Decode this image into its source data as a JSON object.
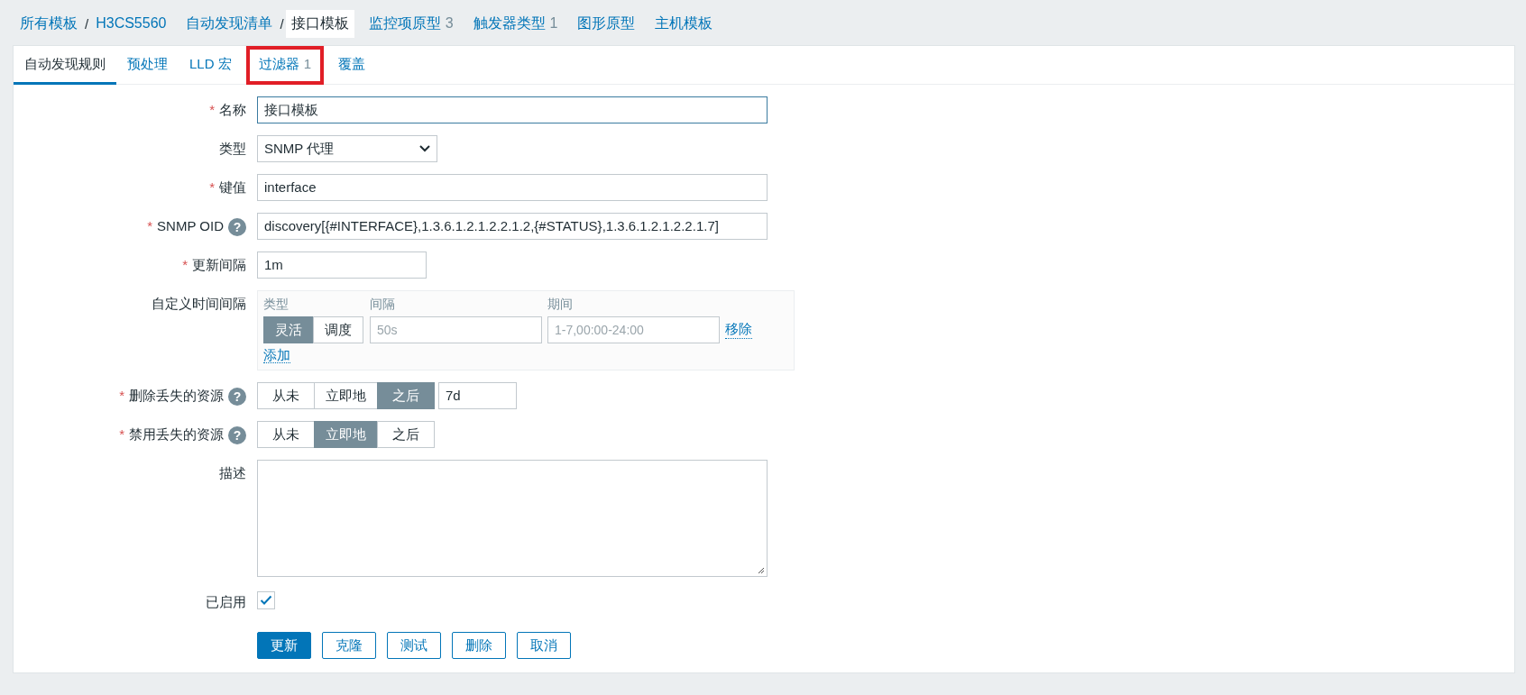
{
  "nav": [
    {
      "kind": "link",
      "label": "所有模板"
    },
    {
      "kind": "separator",
      "label": "/"
    },
    {
      "kind": "link",
      "label": "H3CS5560"
    },
    {
      "kind": "link",
      "label": "自动发现清单"
    },
    {
      "kind": "separator",
      "label": "/"
    },
    {
      "kind": "current",
      "label": "接口模板"
    },
    {
      "kind": "link",
      "label": "监控项原型",
      "count": "3"
    },
    {
      "kind": "link",
      "label": "触发器类型",
      "count": "1"
    },
    {
      "kind": "link",
      "label": "图形原型"
    },
    {
      "kind": "link",
      "label": "主机模板"
    }
  ],
  "tabs": [
    {
      "label": "自动发现规则",
      "selected": true,
      "highlighted": false
    },
    {
      "label": "预处理",
      "selected": false,
      "highlighted": false
    },
    {
      "label": "LLD 宏",
      "selected": false,
      "highlighted": false
    },
    {
      "label": "过滤器",
      "count": "1",
      "selected": false,
      "highlighted": true
    },
    {
      "label": "覆盖",
      "selected": false,
      "highlighted": false
    }
  ],
  "fields": [
    {
      "kind": "text",
      "label": "名称",
      "required": "*",
      "value": "接口模板",
      "focused": true
    },
    {
      "kind": "select",
      "label": "类型",
      "value": "SNMP 代理"
    },
    {
      "kind": "text",
      "label": "键值",
      "required": "*",
      "value": "interface",
      "focused": false
    },
    {
      "kind": "text",
      "label": "SNMP OID",
      "required": "*",
      "help": "?",
      "value": "discovery[{#INTERFACE},1.3.6.1.2.1.2.2.1.2,{#STATUS},1.3.6.1.2.1.2.2.1.7]",
      "focused": false
    },
    {
      "kind": "text-short",
      "label": "更新间隔",
      "required": "*",
      "value": "1m",
      "focused": false
    },
    {
      "kind": "intervals",
      "label": "自定义时间间隔",
      "headers": [
        "类型",
        "间隔",
        "期间"
      ],
      "rows": [
        {
          "options": [
            {
              "label": "灵活",
              "selected": true
            },
            {
              "label": "调度",
              "selected": false
            }
          ],
          "interval_placeholder": "50s",
          "period_placeholder": "1-7,00:00-24:00",
          "remove": "移除"
        }
      ],
      "add": "添加"
    },
    {
      "kind": "segmented",
      "label": "删除丢失的资源",
      "required": "*",
      "help": "?",
      "options": [
        {
          "label": "从未",
          "selected": false
        },
        {
          "label": "立即地",
          "selected": false
        },
        {
          "label": "之后",
          "selected": true
        }
      ],
      "value": "7d"
    },
    {
      "kind": "segmented",
      "label": "禁用丢失的资源",
      "required": "*",
      "help": "?",
      "options": [
        {
          "label": "从未",
          "selected": false
        },
        {
          "label": "立即地",
          "selected": true
        },
        {
          "label": "之后",
          "selected": false
        }
      ]
    },
    {
      "kind": "textarea",
      "label": "描述"
    },
    {
      "kind": "checkbox",
      "label": "已启用",
      "checked": true
    }
  ],
  "buttons": [
    {
      "label": "更新",
      "primary": true
    },
    {
      "label": "克隆",
      "primary": false
    },
    {
      "label": "测试",
      "primary": false
    },
    {
      "label": "删除",
      "primary": false
    },
    {
      "label": "取消",
      "primary": false
    }
  ]
}
